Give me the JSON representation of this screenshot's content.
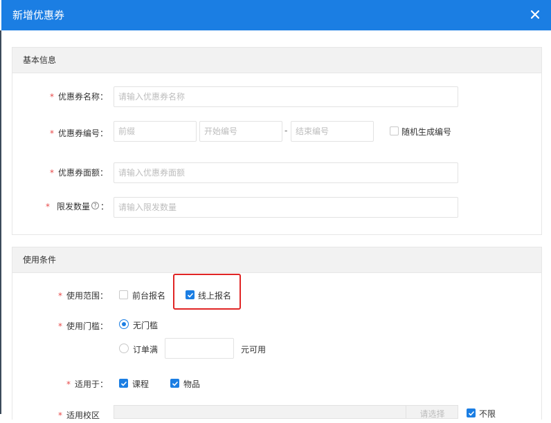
{
  "dialog": {
    "title": "新增优惠券"
  },
  "basic": {
    "title": "基本信息",
    "name": {
      "label": "优惠券名称：",
      "placeholder": "请输入优惠券名称"
    },
    "code": {
      "label": "优惠券编号：",
      "prefix": "前缀",
      "start": "开始编号",
      "dash": "-",
      "end": "结束编号",
      "random": "随机生成编号",
      "random_checked": false
    },
    "amount": {
      "label": "优惠券面额：",
      "placeholder": "请输入优惠券面额"
    },
    "limit": {
      "label": "限发数量",
      "colon": "：",
      "placeholder": "请输入限发数量",
      "help_icon": "question-circle-icon"
    }
  },
  "conditions": {
    "title": "使用条件",
    "scope": {
      "label": "使用范围：",
      "options": [
        {
          "label": "前台报名",
          "checked": false
        },
        {
          "label": "线上报名",
          "checked": true
        }
      ]
    },
    "threshold": {
      "label": "使用门槛：",
      "none": "无门槛",
      "order_full": "订单满",
      "suffix": "元可用",
      "selected": "无门槛"
    },
    "apply": {
      "label": "适用于：",
      "options": [
        {
          "label": "课程",
          "checked": true
        },
        {
          "label": "物品",
          "checked": true
        }
      ]
    },
    "campus": {
      "label": "适用校区",
      "button": "请选择",
      "unlimited": "不限",
      "unlimited_checked": true
    }
  },
  "colors": {
    "primary": "#1b7ee3",
    "required": "#e84a4a",
    "highlight": "#e02424"
  }
}
